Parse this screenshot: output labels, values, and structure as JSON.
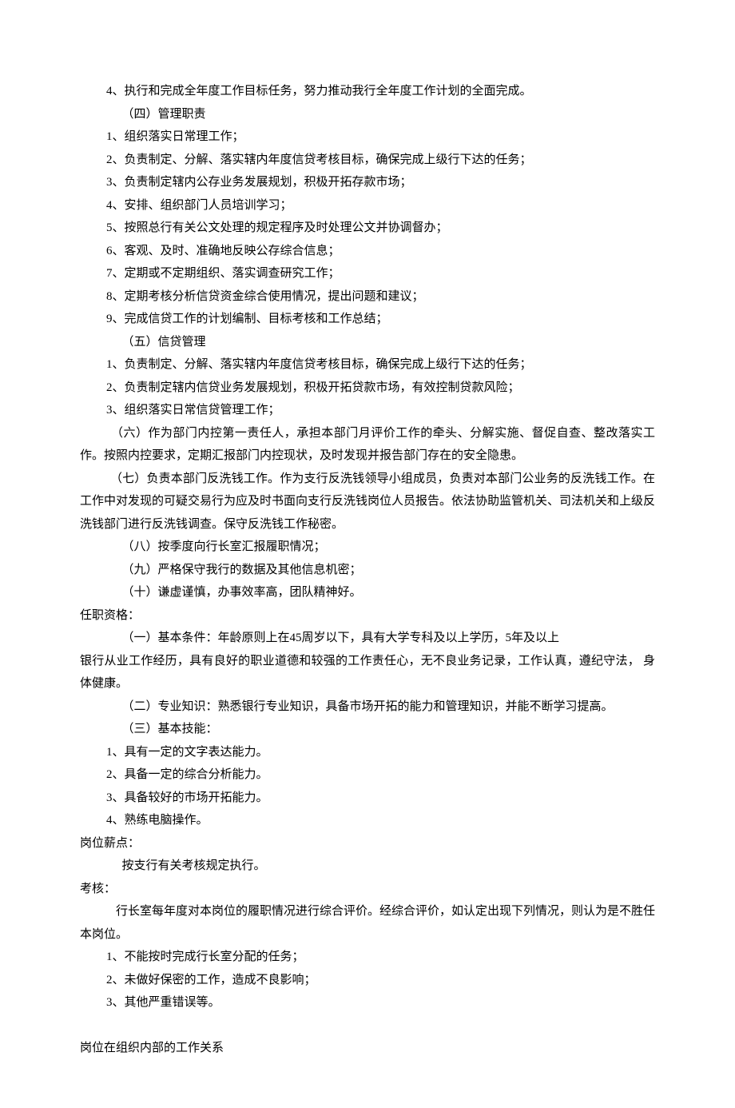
{
  "lines": [
    {
      "cls": "indent-1",
      "text": "4、执行和完成全年度工作目标任务，努力推动我行全年度工作计划的全面完成。"
    },
    {
      "cls": "indent-2",
      "text": "（四）管理职责"
    },
    {
      "cls": "indent-1",
      "text": "1、组织落实日常理工作；"
    },
    {
      "cls": "indent-1",
      "text": "2、负责制定、分解、落实辖内年度信贷考核目标，确保完成上级行下达的任务；"
    },
    {
      "cls": "indent-1",
      "text": "3、负责制定辖内公存业务发展规划，积极开拓存款市场；"
    },
    {
      "cls": "indent-1",
      "text": "4、安排、组织部门人员培训学习；"
    },
    {
      "cls": "indent-1",
      "text": "5、按照总行有关公文处理的规定程序及时处理公文并协调督办；"
    },
    {
      "cls": "indent-1",
      "text": "6、客观、及时、准确地反映公存综合信息；"
    },
    {
      "cls": "indent-1",
      "text": "7、定期或不定期组织、落实调查研究工作；"
    },
    {
      "cls": "indent-1",
      "text": "8、定期考核分析信贷资金综合使用情况，提出问题和建议；"
    },
    {
      "cls": "indent-1",
      "text": "9、完成信贷工作的计划编制、目标考核和工作总结；"
    },
    {
      "cls": "indent-2",
      "text": "（五）信贷管理"
    },
    {
      "cls": "indent-1",
      "text": "1、负责制定、分解、落实辖内年度信贷考核目标，确保完成上级行下达的任务；"
    },
    {
      "cls": "indent-1",
      "text": "2、负责制定辖内信贷业务发展规划，积极开拓贷款市场，有效控制贷款风险；"
    },
    {
      "cls": "indent-1",
      "text": "3、组织落实日常信贷管理工作；"
    },
    {
      "cls": "para",
      "text": "　　　（六）作为部门内控第一责任人，承担本部门月评价工作的牵头、分解实施、督促自查、整改落实工作。按照内控要求，定期汇报部门内控现状，及时发现并报告部门存在的安全隐患。"
    },
    {
      "cls": "para",
      "text": "　　　（七）负责本部门反洗钱工作。作为支行反洗钱领导小组成员，负责对本部门公业务的反洗钱工作。在工作中对发现的可疑交易行为应及时书面向支行反洗钱岗位人员报告。依法协助监管机关、司法机关和上级反洗钱部门进行反洗钱调查。保守反洗钱工作秘密。"
    },
    {
      "cls": "indent-2",
      "text": "（八）按季度向行长室汇报履职情况；"
    },
    {
      "cls": "indent-2",
      "text": "（九）严格保守我行的数据及其他信息机密；"
    },
    {
      "cls": "indent-2",
      "text": "（十）谦虚谨慎，办事效率高，团队精神好。"
    },
    {
      "cls": "no-indent",
      "text": "任职资格："
    },
    {
      "cls": "indent-2",
      "text": "（一）基本条件：年龄原则上在45周岁以下，具有大学专科及以上学历，5年及以上"
    },
    {
      "cls": "para",
      "text": "银行从业工作经历，具有良好的职业道德和较强的工作责任心，无不良业务记录，工作认真，遵纪守法， 身体健康。"
    },
    {
      "cls": "indent-2",
      "text": "（二）专业知识：熟悉银行专业知识，具备市场开拓的能力和管理知识，并能不断学习提高。"
    },
    {
      "cls": "indent-2",
      "text": "（三）基本技能："
    },
    {
      "cls": "indent-1",
      "text": "1、具有一定的文字表达能力。"
    },
    {
      "cls": "indent-1",
      "text": "2、具备一定的综合分析能力。"
    },
    {
      "cls": "indent-1",
      "text": "3、具备较好的市场开拓能力。"
    },
    {
      "cls": "indent-1",
      "text": "4、熟练电脑操作。"
    },
    {
      "cls": "no-indent",
      "text": "岗位薪点："
    },
    {
      "cls": "indent-2",
      "text": "按支行有关考核规定执行。"
    },
    {
      "cls": "no-indent",
      "text": "考核："
    },
    {
      "cls": "para",
      "text": "　　　行长室每年度对本岗位的履职情况进行综合评价。经综合评价，如认定出现下列情况，则认为是不胜任本岗位。"
    },
    {
      "cls": "indent-1",
      "text": "1、不能按时完成行长室分配的任务；"
    },
    {
      "cls": "indent-1",
      "text": "2、未做好保密的工作，造成不良影响；"
    },
    {
      "cls": "indent-1",
      "text": "3、其他严重错误等。"
    },
    {
      "cls": "blank",
      "text": ""
    },
    {
      "cls": "no-indent",
      "text": "岗位在组织内部的工作关系"
    }
  ]
}
